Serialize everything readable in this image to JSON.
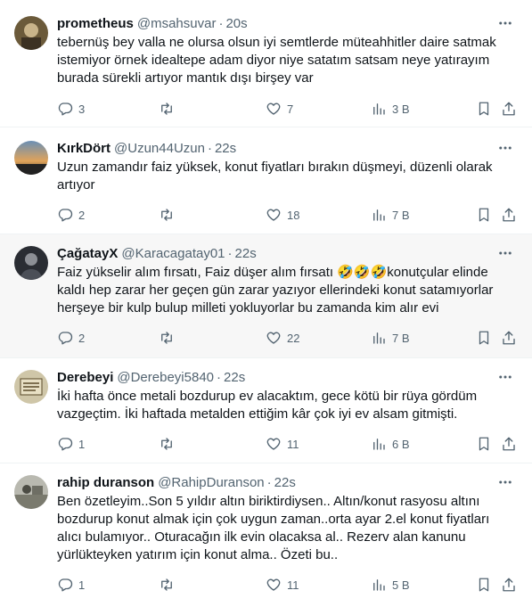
{
  "tweets": [
    {
      "name": "prometheus",
      "handle": "@msahsuvar",
      "sep": "·",
      "time": "20s",
      "lines": [
        "tebernüş bey valla ne olursa olsun iyi semtlerde müteahhitler daire satmak",
        "istemiyor örnek idealtepe adam diyor niye satatım satsam neye yatırayım",
        "burada sürekli artıyor mantık dışı birşey var"
      ],
      "replies": "3",
      "retweets": "",
      "likes": "7",
      "views": "3 B"
    },
    {
      "name": "KırkDört",
      "handle": "@Uzun44Uzun",
      "sep": "·",
      "time": "22s",
      "lines": [
        "Uzun zamandır faiz yüksek, konut fiyatları bırakın düşmeyi, düzenli olarak",
        "artıyor"
      ],
      "replies": "2",
      "retweets": "",
      "likes": "18",
      "views": "7 B"
    },
    {
      "name": "ÇağatayX",
      "handle": "@Karacagatay01",
      "sep": "·",
      "time": "22s",
      "lines": [
        "Faiz yükselir alım fırsatı, Faiz düşer alım fırsatı 🤣🤣🤣konutçular elinde",
        "kaldı hep zarar her geçen gün zarar yazıyor ellerindeki konut satamıyorlar",
        "herşeye bir kulp bulup milleti yokluyorlar bu zamanda kim alır evi"
      ],
      "replies": "2",
      "retweets": "",
      "likes": "22",
      "views": "7 B"
    },
    {
      "name": "Derebeyi",
      "handle": "@Derebeyi5840",
      "sep": "·",
      "time": "22s",
      "lines": [
        "İki hafta önce metali bozdurup ev alacaktım, gece kötü bir rüya gördüm",
        "vazgeçtim. İki haftada metalden ettiğim kâr çok iyi ev alsam gitmişti."
      ],
      "replies": "1",
      "retweets": "",
      "likes": "11",
      "views": "6 B"
    },
    {
      "name": "rahip duranson",
      "handle": "@RahipDuranson",
      "sep": "·",
      "time": "22s",
      "lines": [
        "Ben özetleyim..Son 5 yıldır altın biriktirdiysen.. Altın/konut rasyosu altını",
        "bozdurup konut almak için çok uygun zaman..orta ayar 2.el konut fiyatları",
        "alıcı bulamıyor.. Oturacağın ilk evin olacaksa al.. Rezerv alan kanunu",
        "yürlükteyken yatırım için konut alma.. Özeti bu.."
      ],
      "replies": "1",
      "retweets": "",
      "likes": "11",
      "views": "5 B"
    }
  ],
  "icons": {
    "reply": "reply-icon",
    "retweet": "retweet-icon",
    "like": "heart-icon",
    "views": "views-icon",
    "bookmark": "bookmark-icon",
    "share": "share-icon",
    "more": "more-icon"
  },
  "colors": {
    "text": "#0f1419",
    "secondary": "#536471",
    "border": "#eff3f4",
    "highlight": "#f7f7f7"
  }
}
